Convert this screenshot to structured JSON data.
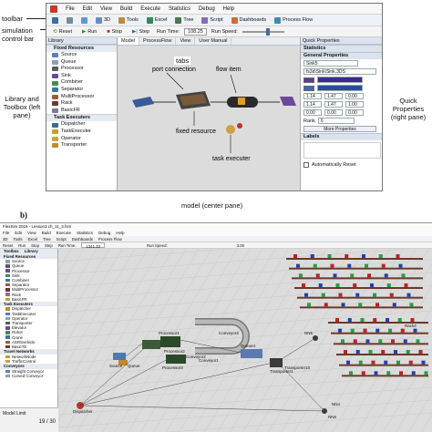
{
  "panel_b_label": "b)",
  "callouts": {
    "toolbar": "toolbar",
    "sim_control": "simulation control bar",
    "library": "Library and Toolbox (left pane)",
    "quick_props": "Quick Properties (right pane)",
    "tabs": "tabs",
    "model": "model (center pane)",
    "port_connection": "port connection",
    "flow_item": "flow item",
    "fixed_resource": "fixed resource",
    "task_executer": "task executer"
  },
  "panel_a": {
    "menu": [
      "File",
      "Edit",
      "View",
      "Build",
      "Execute",
      "Statistics",
      "Debug",
      "Help"
    ],
    "toolbar": [
      "3D",
      "Tools",
      "Excel",
      "Tree",
      "Script",
      "Dashboards",
      "Process Flow"
    ],
    "run": {
      "reset": "Reset",
      "run": "Run",
      "stop": "Stop",
      "step": "Step",
      "run_time_label": "Run Time:",
      "run_time": "108.25",
      "speed_label": "Run Speed:"
    },
    "library_title": "Library",
    "groups": [
      {
        "name": "Fixed Resources",
        "items": [
          "Source",
          "Queue",
          "Processor",
          "Sink",
          "Combiner",
          "Separator",
          "MultiProcessor",
          "Rack",
          "BasicFR"
        ]
      },
      {
        "name": "Task Executers",
        "items": [
          "Dispatcher",
          "TaskExecuter",
          "Operator",
          "Transporter"
        ]
      }
    ],
    "tabs": [
      "Model",
      "ProcessFlow",
      "View",
      "User Manual"
    ],
    "quick_properties": {
      "title": "Quick Properties",
      "statistics": "Statistics",
      "general": "General Properties",
      "name": "Sink5",
      "shape": "fs3d\\Sink\\Sink.3DS",
      "values": [
        "1.14",
        "1.47",
        "0.00",
        "1.14",
        "1.47",
        "1.00",
        "0.00",
        "0.00",
        "0.00"
      ],
      "rank_label": "Rank",
      "rank": "6",
      "more": "More Properties",
      "labels": "Labels",
      "auto_reset": "Automatically Reset"
    }
  },
  "panel_b": {
    "title": "FlexSim 2016 - Lesson3.ch_11_3.fsm",
    "menu": [
      "File",
      "Edit",
      "View",
      "Build",
      "Execute",
      "Statistics",
      "Debug",
      "Help"
    ],
    "toolbar": [
      "3D",
      "Tools",
      "Excel",
      "Tree",
      "Script",
      "Dashboards",
      "Process Flow"
    ],
    "run": {
      "reset": "Reset",
      "run": "Run",
      "stop": "Stop",
      "step": "Step",
      "run_time_label": "Run Time:",
      "run_time": "1341.33",
      "speed_label": "Run Speed:",
      "speed": "3.00"
    },
    "lib_tabs": [
      "Toolbox",
      "Library"
    ],
    "lib_items": [
      {
        "g": "Fixed Resources"
      },
      {
        "i": "Source"
      },
      {
        "i": "Queue"
      },
      {
        "i": "Processor"
      },
      {
        "i": "Sink"
      },
      {
        "i": "Combiner"
      },
      {
        "i": "Separator"
      },
      {
        "i": "MultiProcessor"
      },
      {
        "i": "Rack"
      },
      {
        "i": "BasicFR"
      },
      {
        "g": "Task Executers"
      },
      {
        "i": "Dispatcher"
      },
      {
        "i": "TaskExecuter"
      },
      {
        "i": "Operator"
      },
      {
        "i": "Transporter"
      },
      {
        "i": "Elevator"
      },
      {
        "i": "Robot"
      },
      {
        "i": "Crane"
      },
      {
        "i": "ASRSvehicle"
      },
      {
        "i": "BasicTE"
      },
      {
        "g": "Travel Networks"
      },
      {
        "i": "NetworkNode"
      },
      {
        "i": "TrafficControl"
      },
      {
        "g": "Conveyors"
      },
      {
        "i": "Straight Conveyor"
      },
      {
        "i": "Curved Conveyor"
      }
    ],
    "model_limit_label": "Model Limit",
    "model_limit": "19 / 30",
    "canvas_labels": [
      "Source",
      "Queue",
      "Processor1",
      "Processor2",
      "Processor3",
      "Conveyor1",
      "Conveyor2",
      "Conveyor3",
      "Queue4",
      "Dispatcher",
      "Transporter1",
      "Transporter10",
      "Rack4",
      "NN5",
      "NN6",
      "NN4"
    ]
  },
  "colors": {
    "accent": "#3a6ea5",
    "title_bg": "#dbe3ee",
    "canvas": "#dcdcdc",
    "rack": "#6b3a2a"
  }
}
